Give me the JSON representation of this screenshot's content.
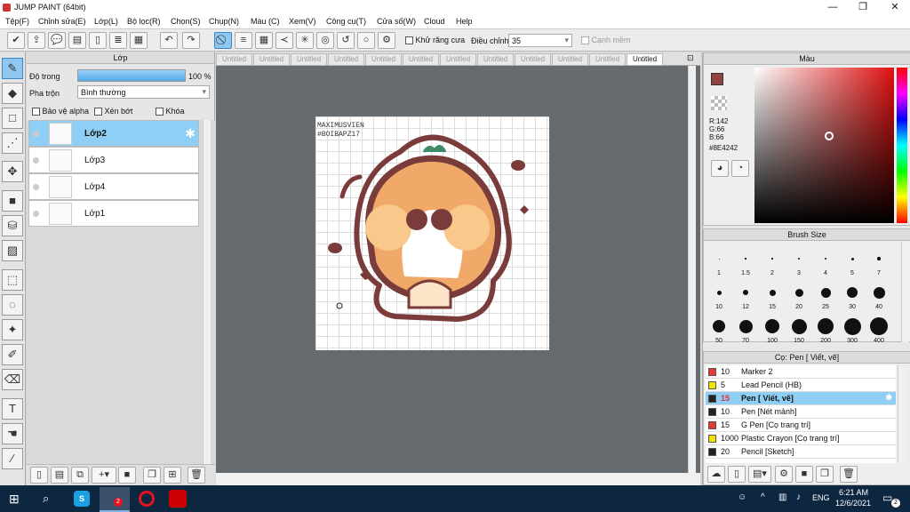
{
  "window": {
    "title": "JUMP PAINT (64bit)",
    "min": "—",
    "max": "❐",
    "close": "✕"
  },
  "menu": [
    "Tệp(F)",
    "Chỉnh sửa(E)",
    "Lớp(L)",
    "Bộ lọc(R)",
    "Chọn(S)",
    "Chụp(N)",
    "Màu (C)",
    "Xem(V)",
    "Công cụ(T)",
    "Cửa số(W)",
    "Cloud",
    "Help"
  ],
  "toolbar": {
    "antialias_label": "Khử răng cưa",
    "adjust_label": "Điều chỉnh",
    "adjust_value": "35",
    "snap_label": "Cạnh mềm"
  },
  "layer_panel": {
    "title": "Lớp",
    "opacity_label": "Độ trong",
    "opacity_value": "100 %",
    "opacity": 1.0,
    "blend_label": "Pha trộn",
    "blend_value": "Bình thường",
    "protect_alpha": "Bảo vệ alpha",
    "clip": "Xén bớt",
    "lock": "Khóa",
    "layers": [
      {
        "name": "Lớp2"
      },
      {
        "name": "Lớp3"
      },
      {
        "name": "Lớp4"
      },
      {
        "name": "Lớp1"
      }
    ]
  },
  "tabs": [
    "Untitled",
    "Untitled",
    "Untitled",
    "Untitled",
    "Untitled",
    "Untitled",
    "Untitled",
    "Untitled",
    "Untitled",
    "Untitled",
    "Untitled",
    "Untitled"
  ],
  "artwork": {
    "watermark_line1": "MAXIMUSVIEN",
    "watermark_line2": "#BOIBAPZ17"
  },
  "color_panel": {
    "title": "Màu",
    "r": "R:142",
    "g": "G:66",
    "b": "B:66",
    "hex": "#8E4242",
    "current_color": "#8E4242"
  },
  "brush_size": {
    "title": "Brush Size",
    "sizes": [
      "1",
      "1.5",
      "2",
      "3",
      "4",
      "5",
      "7",
      "10",
      "12",
      "15",
      "20",
      "25",
      "30",
      "40",
      "50",
      "70",
      "100",
      "150",
      "200",
      "300",
      "400"
    ]
  },
  "brush_list": {
    "title": "Cọ: Pen [ Viết, vẽ]",
    "items": [
      {
        "size": "10",
        "name": "Marker 2",
        "color": "#e53935"
      },
      {
        "size": "5",
        "name": "Lead Pencil (HB)",
        "color": "#f2e200"
      },
      {
        "size": "15",
        "name": "Pen [ Viết, vẽ]",
        "color": "#222222"
      },
      {
        "size": "10",
        "name": "Pen [Nét mảnh]",
        "color": "#222222"
      },
      {
        "size": "15",
        "name": "G Pen [Cọ trang trí]",
        "color": "#e53935"
      },
      {
        "size": "1000",
        "name": "Plastic Crayon [Cọ trang trí]",
        "color": "#f2e200"
      },
      {
        "size": "20",
        "name": "Pencil [Sketch]",
        "color": "#222222"
      }
    ]
  },
  "taskbar": {
    "time": "6:21 AM",
    "date": "12/6/2021",
    "lang": "ENG",
    "notif": "2",
    "badge": "2"
  }
}
